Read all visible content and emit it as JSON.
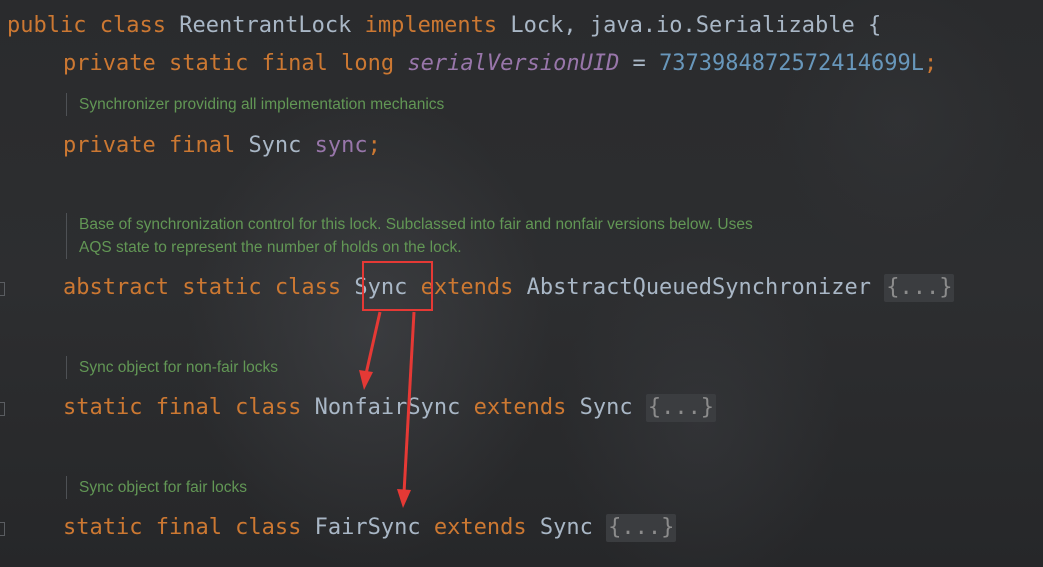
{
  "code": {
    "line1": {
      "kw_public": "public",
      "kw_class": "class",
      "name": "ReentrantLock",
      "kw_implements": "implements",
      "ifaces": "Lock, java.io.Serializable {"
    },
    "line2": {
      "mods": "private static final long",
      "field": "serialVersionUID",
      "eq": " = ",
      "value": "7373984872572414699L",
      "semi": ";"
    },
    "doc1": "Synchronizer providing all implementation mechanics",
    "line3": {
      "mods": "private final",
      "type": "Sync",
      "field": "sync",
      "semi": ";"
    },
    "doc2_line1": "Base of synchronization control for this lock. Subclassed into fair and nonfair versions below. Uses",
    "doc2_line2": "AQS state to represent the number of holds on the lock.",
    "line4": {
      "mods": "abstract static class",
      "name": "Sync",
      "kw_extends": "extends",
      "parent": "AbstractQueuedSynchronizer",
      "fold": "{...}"
    },
    "doc3": "Sync object for non-fair locks",
    "line5": {
      "mods": "static final class",
      "name": "NonfairSync",
      "kw_extends": "extends",
      "parent": "Sync",
      "fold": "{...}"
    },
    "doc4": "Sync object for fair locks",
    "line6": {
      "mods": "static final class",
      "name": "FairSync",
      "kw_extends": "extends",
      "parent": "Sync",
      "fold": "{...}"
    }
  },
  "annotation": {
    "highlight_color": "#e53935",
    "arrow_color": "#e53935"
  },
  "icons": {
    "gutter": "fold-marker-icon"
  }
}
